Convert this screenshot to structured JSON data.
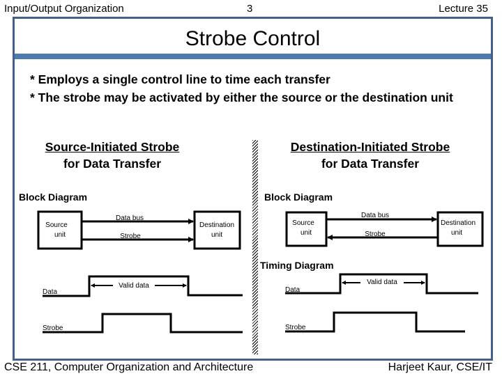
{
  "header": {
    "left": "Input/Output Organization",
    "center": "3",
    "right": "Lecture 35"
  },
  "title": "Strobe Control",
  "bullets": [
    "* Employs a single control line to time each transfer",
    "* The strobe may be activated by either the source or the destination unit"
  ],
  "source_initiated": {
    "title_line1": "Source-Initiated Strobe",
    "title_line2": "for Data Transfer",
    "block_label": "Block Diagram",
    "source_box": [
      "Source",
      "unit"
    ],
    "dest_box": [
      "Destination",
      "unit"
    ],
    "line1_label": "Data bus",
    "line2_label": "Strobe",
    "timing": {
      "data_label": "Data",
      "strobe_label": "Strobe",
      "valid_label": "Valid data"
    }
  },
  "destination_initiated": {
    "title_line1": "Destination-Initiated Strobe",
    "title_line2": "for Data Transfer",
    "block_label": "Block Diagram",
    "source_box": [
      "Source",
      "unit"
    ],
    "dest_box": [
      "Destination",
      "unit"
    ],
    "line1_label": "Data bus",
    "line2_label": "Strobe",
    "timing_label": "Timing Diagram",
    "timing": {
      "data_label": "Data",
      "strobe_label": "Strobe",
      "valid_label": "Valid data"
    }
  },
  "footer": {
    "left": "CSE 211, Computer Organization and Architecture",
    "right": "Harjeet Kaur, CSE/IT"
  },
  "colors": {
    "frame": "#41618a",
    "title_bar": "#4f7bb3"
  }
}
